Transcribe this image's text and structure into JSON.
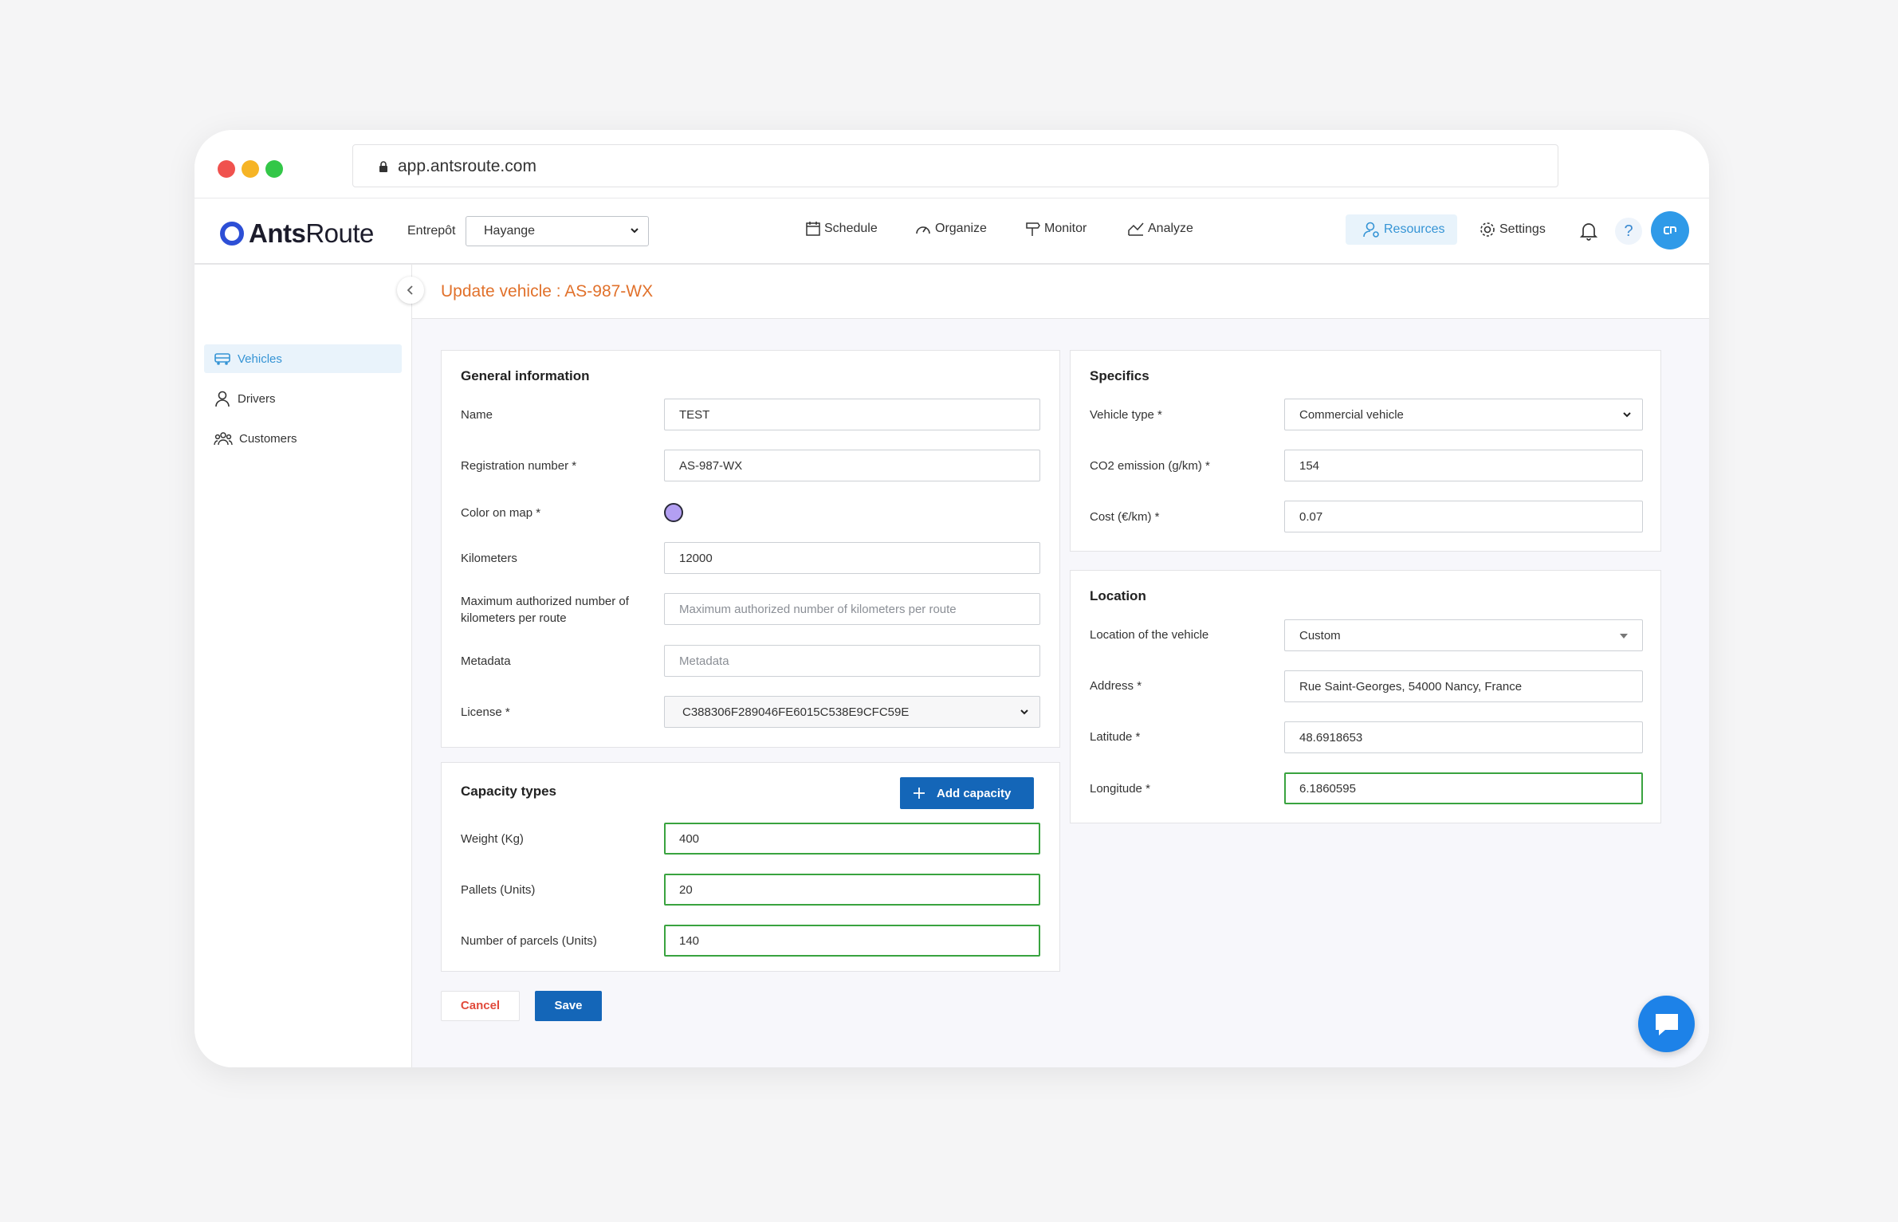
{
  "browser": {
    "url": "app.antsroute.com"
  },
  "app": {
    "brand_bold": "Ants",
    "brand_light": "Route",
    "entrepot_label": "Entrepôt",
    "entrepot_value": "Hayange",
    "nav": {
      "schedule": "Schedule",
      "organize": "Organize",
      "monitor": "Monitor",
      "analyze": "Analyze",
      "resources": "Resources",
      "settings": "Settings",
      "help": "?"
    }
  },
  "sidebar": {
    "items": [
      {
        "label": "Vehicles",
        "active": true
      },
      {
        "label": "Drivers",
        "active": false
      },
      {
        "label": "Customers",
        "active": false
      }
    ]
  },
  "page": {
    "title": "Update vehicle : AS-987-WX"
  },
  "general": {
    "heading": "General information",
    "name_label": "Name",
    "name_value": "TEST",
    "reg_label": "Registration number *",
    "reg_value": "AS-987-WX",
    "color_label": "Color on map *",
    "color_value": "#b39ff2",
    "km_label": "Kilometers",
    "km_value": "12000",
    "maxkm_label": "Maximum authorized number of kilometers per route",
    "maxkm_placeholder": "Maximum authorized number of kilometers per route",
    "meta_label": "Metadata",
    "meta_placeholder": "Metadata",
    "license_label": "License *",
    "license_value": "C388306F289046FE6015C538E9CFC59E"
  },
  "capacity": {
    "heading": "Capacity types",
    "add_label": "Add capacity",
    "rows": [
      {
        "label": "Weight (Kg)",
        "value": "400"
      },
      {
        "label": "Pallets (Units)",
        "value": "20"
      },
      {
        "label": "Number of parcels (Units)",
        "value": "140"
      }
    ]
  },
  "specifics": {
    "heading": "Specifics",
    "type_label": "Vehicle type *",
    "type_value": "Commercial vehicle",
    "co2_label": "CO2 emission (g/km) *",
    "co2_value": "154",
    "cost_label": "Cost (€/km) *",
    "cost_value": "0.07"
  },
  "location": {
    "heading": "Location",
    "loc_label": "Location of the vehicle",
    "loc_value": "Custom",
    "address_label": "Address *",
    "address_value": "Rue Saint-Georges, 54000 Nancy, France",
    "lat_label": "Latitude *",
    "lat_value": "48.6918653",
    "lng_label": "Longitude *",
    "lng_value": "6.1860595"
  },
  "actions": {
    "cancel": "Cancel",
    "save": "Save"
  },
  "colors": {
    "accent": "#1466b8",
    "title": "#e1712b",
    "active": "#3594d5",
    "valid": "#39a33f"
  }
}
